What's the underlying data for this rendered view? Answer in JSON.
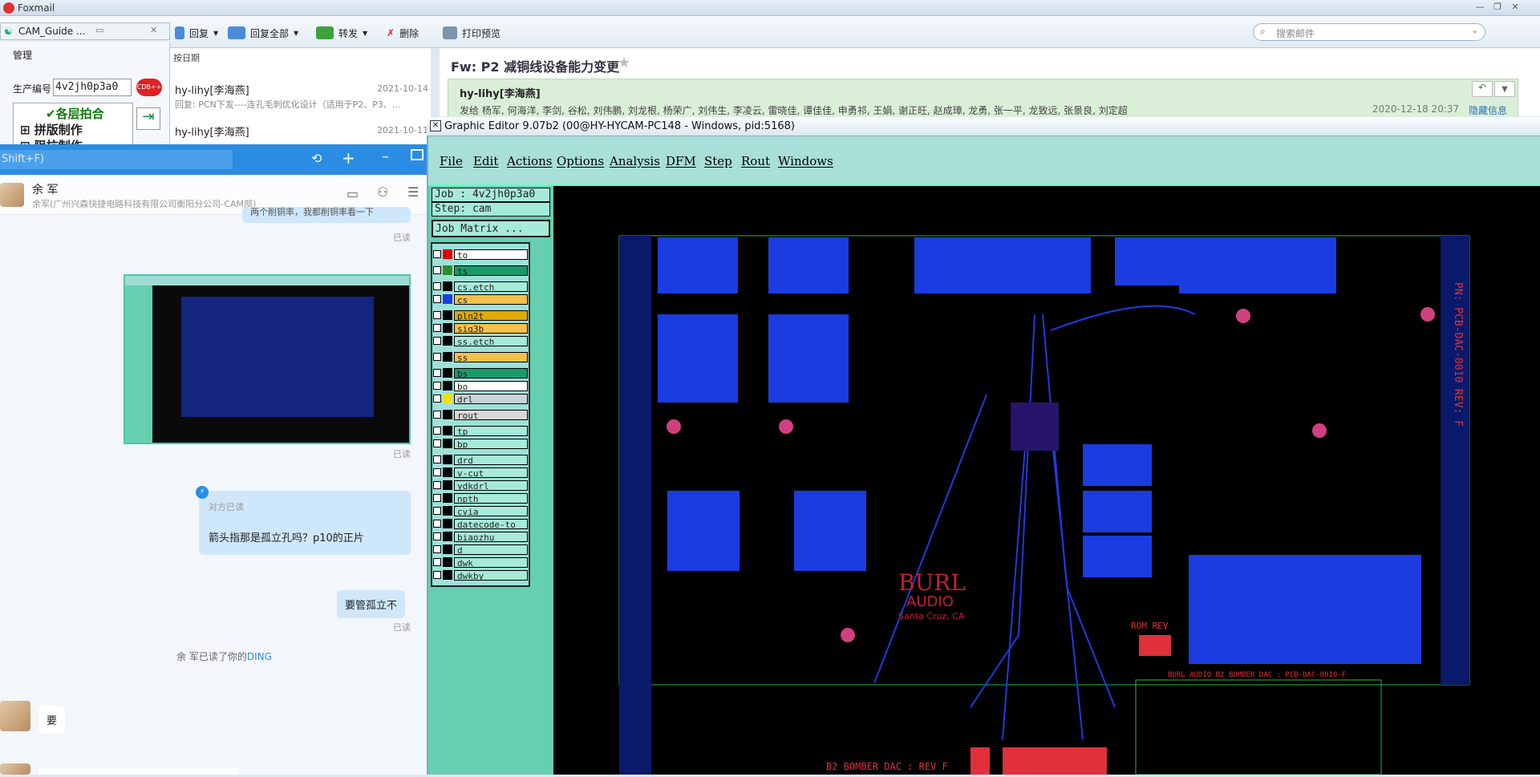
{
  "foxmail": {
    "title": "Foxmail",
    "toolbar": {
      "reply": "回复",
      "reply_all": "回复全部",
      "forward": "转发",
      "delete": "删除",
      "print_preview": "打印预览"
    },
    "search_placeholder": "搜索邮件",
    "left_tab": "CAM_Guide ...",
    "manage": "管理",
    "prod_no_label": "生产编号",
    "prod_no_value": "4v2jh0p3a0",
    "tree": [
      "各层拍合",
      "拼版制作",
      "阻抗制作"
    ],
    "sort_label": "按日期",
    "mails": [
      {
        "sender": "hy-lihy[李海燕]",
        "date": "2021-10-14",
        "preview": "回复: PCN下发----连孔毛刺优化设计（适用于P2、P3、..."
      },
      {
        "sender": "hy-lihy[李海燕]",
        "date": "2021-10-11"
      }
    ],
    "subject": "Fw: P2 减铜线设备能力变更",
    "from": "hy-lihy[李海燕]",
    "recipients": "发给 杨军, 何海洋, 李剑, 谷松, 刘伟鹏, 刘龙根, 杨荣广, 刘伟生, 李凌云, 雷晓佳, 谭佳佳, 申勇祁, 王娟, 谢正旺, 赵成璋, 龙勇, 张一平, 龙致远, 张景良, 刘定超",
    "sent_time": "2020-12-18 20:37",
    "hide_info": "隐藏信息"
  },
  "chat": {
    "search_hint": "Shift+F)",
    "contact_name": "余 军",
    "contact_org": "余军(广州兴森快捷电路科技有限公司衡阳分公司-CAM部)",
    "prev_msg_snip": "两个削铜率，我都削铜率看一下",
    "read": "已读",
    "peer_read": "对方已读",
    "msg_question": "箭头指那是孤立孔吗？p10的正片",
    "msg_reply": "要管孤立不",
    "ding_notice_prefix": "余 军已读了你的",
    "ding": "DING",
    "incoming": "要"
  },
  "editor": {
    "title": "Graphic Editor 9.07b2 (00@HY-HYCAM-PC148 - Windows, pid:5168)",
    "menu": [
      "File",
      "Edit",
      "Actions",
      "Options",
      "Analysis",
      "DFM",
      "Step",
      "Rout",
      "Windows"
    ],
    "job": "Job : 4v2jh0p3a0",
    "step": "Step: cam",
    "job_matrix": "Job Matrix ...",
    "layers": [
      {
        "name": "to",
        "color": "#ffffff",
        "swatch": "#e00000"
      },
      {
        "name": "ts",
        "color": "#1a9a6a",
        "swatch": "#2a8f2a"
      },
      {
        "name": "cs.etch",
        "color": "#a6ead8",
        "swatch": "#000000"
      },
      {
        "name": "cs",
        "color": "#f4c14a",
        "swatch": "#1b3ce0"
      },
      {
        "name": "pln2t",
        "color": "#e0a800",
        "swatch": "#000000"
      },
      {
        "name": "sig3b",
        "color": "#f4c14a",
        "swatch": "#000000"
      },
      {
        "name": "ss.etch",
        "color": "#a6ead8",
        "swatch": "#000000"
      },
      {
        "name": "ss",
        "color": "#f4c14a",
        "swatch": "#000000"
      },
      {
        "name": "bs",
        "color": "#1a9a6a",
        "swatch": "#000000"
      },
      {
        "name": "bo",
        "color": "#ffffff",
        "swatch": "#000000"
      },
      {
        "name": "drl",
        "color": "#c8d4d8",
        "swatch": "#f0e000"
      },
      {
        "name": "rout",
        "color": "#d8d8d8",
        "swatch": "#000000"
      },
      {
        "name": "tp",
        "color": "#a6ead8",
        "swatch": "#000000"
      },
      {
        "name": "bp",
        "color": "#a6ead8",
        "swatch": "#000000"
      },
      {
        "name": "drd",
        "color": "#a6ead8",
        "swatch": "#000000"
      },
      {
        "name": "v-cut",
        "color": "#a6ead8",
        "swatch": "#000000"
      },
      {
        "name": "ydkdrl",
        "color": "#a6ead8",
        "swatch": "#000000"
      },
      {
        "name": "npth",
        "color": "#a6ead8",
        "swatch": "#000000"
      },
      {
        "name": "cvia",
        "color": "#a6ead8",
        "swatch": "#000000"
      },
      {
        "name": "datecode-to",
        "color": "#a6ead8",
        "swatch": "#000000"
      },
      {
        "name": "biaozhu",
        "color": "#a6ead8",
        "swatch": "#000000"
      },
      {
        "name": "d",
        "color": "#a6ead8",
        "swatch": "#000000"
      },
      {
        "name": "dwk",
        "color": "#a6ead8",
        "swatch": "#000000"
      },
      {
        "name": "dwkby",
        "color": "#a6ead8",
        "swatch": "#000000"
      }
    ],
    "pcb": {
      "brand": "BURL",
      "brand2": "AUDIO",
      "city": "Santa Cruz, CA",
      "rom_rev": "ROM  REV",
      "board_label": "BURL AUDIO B2 BOMBER DAC : PCB-DAC-0010-F",
      "side_label": "PN: PCB-DAC-0010 REV: F",
      "bottom_label": "B2 BOMBER DAC : REV F"
    }
  }
}
